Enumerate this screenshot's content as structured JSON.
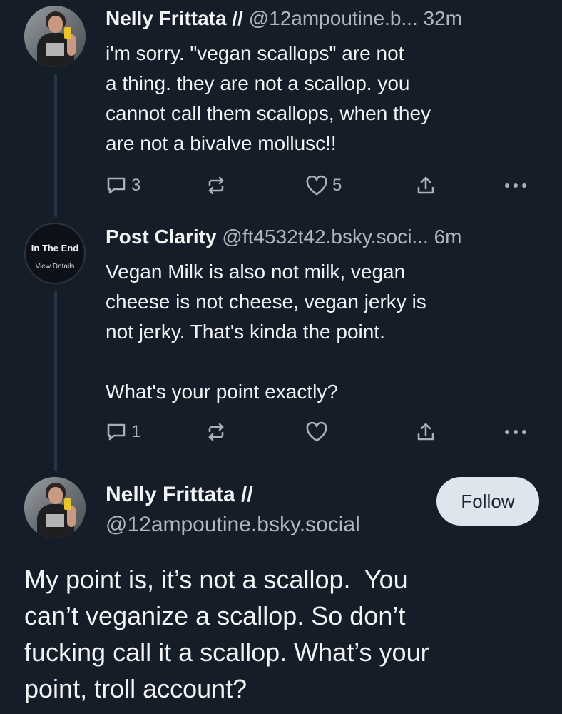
{
  "posts": [
    {
      "author_name": "Nelly Frittata //",
      "handle": "@12ampoutine.b...",
      "time": "32m",
      "text": "i'm sorry. \"vegan scallops\" are not\na thing. they are not a scallop. you\ncannot call them scallops, when they\nare not a bivalve mollusc!!",
      "reply_count": "3",
      "like_count": "5"
    },
    {
      "author_name": "Post Clarity",
      "handle": "@ft4532t42.bsky.soci...",
      "time": "6m",
      "avatar_line1": "In The End",
      "avatar_line2": "View Details",
      "text": "Vegan Milk is also not milk, vegan\ncheese is not cheese, vegan jerky is\nnot jerky. That's kinda the point.\n\nWhat's your point exactly?",
      "reply_count": "1"
    }
  ],
  "focus_post": {
    "author_name": "Nelly Frittata //",
    "handle": "@12ampoutine.bsky.social",
    "follow_label": "Follow",
    "text": "My point is, it’s not a scallop.  You\ncan’t veganize a scallop. So don’t\nfucking call it a scallop. What’s your\npoint, troll account?"
  },
  "icons": [
    "reply-icon",
    "repost-icon",
    "like-icon",
    "share-icon",
    "more-icon"
  ],
  "colors": {
    "background": "#151d28",
    "muted": "#aeb6c0",
    "button": "#dfe5ec"
  }
}
